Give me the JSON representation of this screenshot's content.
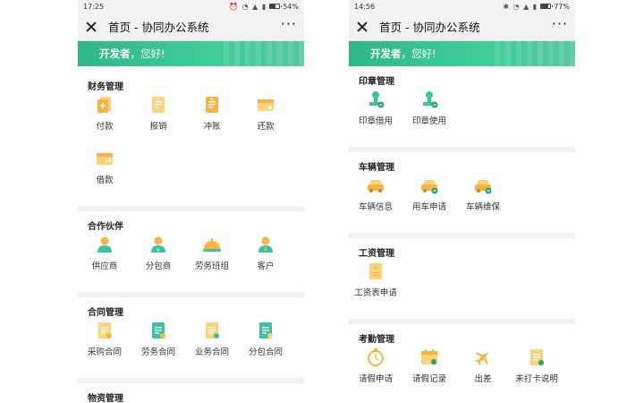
{
  "colors": {
    "accent": "#36c08f",
    "icon_orange": "#f5b544",
    "icon_yellow": "#fbd37a",
    "icon_teal": "#3cc2a0",
    "icon_green": "#29a772"
  },
  "left": {
    "status": {
      "time": "17:25",
      "battery": "54%",
      "battery_level": 0.54
    },
    "titlebar": {
      "title": "首页 - 协同办公系统",
      "more": "···"
    },
    "banner": {
      "name": "开发者",
      "greeting": "，您好!"
    },
    "sections": [
      {
        "title": "财务管理",
        "items": [
          {
            "label": "付款",
            "icon": "payment-icon"
          },
          {
            "label": "报销",
            "icon": "reimburse-icon"
          },
          {
            "label": "冲账",
            "icon": "offset-icon"
          },
          {
            "label": "还款",
            "icon": "repay-icon"
          },
          {
            "label": "借款",
            "icon": "borrow-icon"
          }
        ]
      },
      {
        "title": "合作伙伴",
        "items": [
          {
            "label": "供应商",
            "icon": "supplier-icon"
          },
          {
            "label": "分包商",
            "icon": "subcontractor-icon"
          },
          {
            "label": "劳务班组",
            "icon": "labor-team-icon"
          },
          {
            "label": "客户",
            "icon": "customer-icon"
          }
        ]
      },
      {
        "title": "合同管理",
        "items": [
          {
            "label": "采购合同",
            "icon": "purchase-contract-icon"
          },
          {
            "label": "劳务合同",
            "icon": "labor-contract-icon"
          },
          {
            "label": "业务合同",
            "icon": "business-contract-icon"
          },
          {
            "label": "分包合同",
            "icon": "sub-contract-icon"
          }
        ]
      },
      {
        "title": "物资管理",
        "items": []
      }
    ]
  },
  "right": {
    "status": {
      "time": "14:56",
      "battery": "77%",
      "battery_level": 0.77
    },
    "titlebar": {
      "title": "首页 - 协同办公系统",
      "more": "···"
    },
    "banner": {
      "name": "开发者",
      "greeting": "，您好!"
    },
    "sections": [
      {
        "title": "印章管理",
        "items": [
          {
            "label": "印章借用",
            "icon": "seal-borrow-icon"
          },
          {
            "label": "印章使用",
            "icon": "seal-use-icon"
          }
        ]
      },
      {
        "title": "车辆管理",
        "items": [
          {
            "label": "车辆信息",
            "icon": "vehicle-info-icon"
          },
          {
            "label": "用车申请",
            "icon": "vehicle-apply-icon"
          },
          {
            "label": "车辆维保",
            "icon": "vehicle-maintain-icon"
          }
        ]
      },
      {
        "title": "工资管理",
        "items": [
          {
            "label": "工资表申请",
            "icon": "salary-sheet-icon"
          }
        ]
      },
      {
        "title": "考勤管理",
        "items": [
          {
            "label": "请假申请",
            "icon": "leave-apply-icon"
          },
          {
            "label": "请假记录",
            "icon": "leave-record-icon"
          },
          {
            "label": "出差",
            "icon": "business-trip-icon"
          },
          {
            "label": "未打卡说明",
            "icon": "missed-punch-icon"
          }
        ]
      }
    ]
  }
}
